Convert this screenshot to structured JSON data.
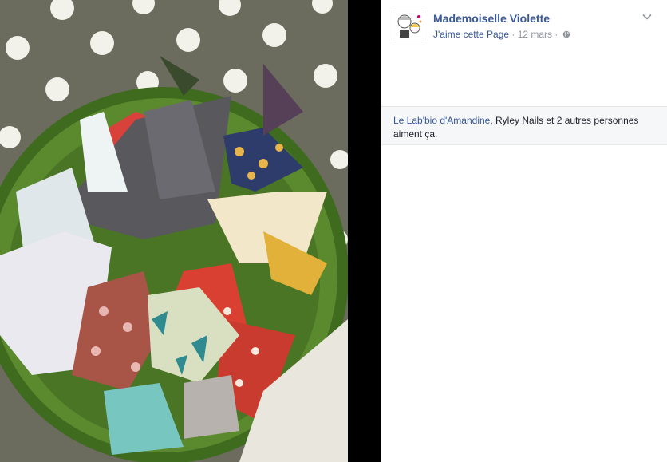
{
  "post": {
    "page_name": "Mademoiselle Violette",
    "like_page_label": "J'aime cette Page",
    "separator": "·",
    "date": "12 mars",
    "icons": {
      "privacy": "globe-icon",
      "options": "chevron-down-icon"
    }
  },
  "likes": {
    "first_liker": "Le Lab'bio d'Amandine",
    "rest": ", Ryley Nails et 2 autres personnes aiment ça."
  },
  "colors": {
    "link": "#365899",
    "page_name": "#3b5998",
    "meta": "#90949c",
    "likes_bg": "#f6f7f9",
    "tablecloth": "#6b6b5e",
    "bowl": "#5b8a2e"
  },
  "photo": {
    "subject": "green bowl of origami butterflies"
  }
}
